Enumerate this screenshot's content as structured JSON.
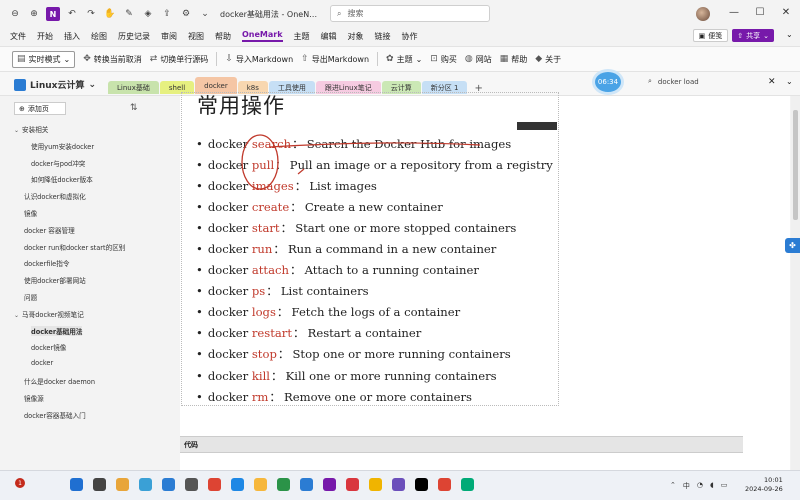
{
  "titlebar": {
    "title": "docker基础用法 - OneN…",
    "search_placeholder": "搜索"
  },
  "menu": {
    "items": [
      "文件",
      "开始",
      "插入",
      "绘图",
      "历史记录",
      "审阅",
      "视图",
      "帮助",
      "OneMark",
      "主题",
      "编辑",
      "对象",
      "链接",
      "协作"
    ],
    "active": "OneMark",
    "sticky_label": "便笺",
    "share_label": "共享"
  },
  "ribbon": {
    "live_mode": "实时模式",
    "convert_current": "转换当前取消",
    "switch_single_line": "切换单行源码",
    "import_markdown": "导入Markdown",
    "export_markdown": "导出Markdown",
    "theme": "主题",
    "buy": "购买",
    "website": "网站",
    "help": "帮助",
    "about": "关于"
  },
  "notebook": {
    "name": "Linux云计算",
    "tabs": [
      {
        "label": "Linux基础",
        "color": "#c8e3ac"
      },
      {
        "label": "shell",
        "color": "#e6f080"
      },
      {
        "label": "docker",
        "color": "#f5c6a5"
      },
      {
        "label": "k8s",
        "color": "#f8d7b0"
      },
      {
        "label": "工具使用",
        "color": "#c6dff5"
      },
      {
        "label": "跟进Linux笔记",
        "color": "#f6cbe1"
      },
      {
        "label": "云计算",
        "color": "#cbe8b5"
      },
      {
        "label": "新分区 1",
        "color": "#c6dff5"
      }
    ],
    "active_tab": "docker",
    "timer": "06:34",
    "page_search": "docker load"
  },
  "sidebar": {
    "add_page": "添加页",
    "items": [
      {
        "label": "安装相关",
        "level": 0,
        "caret": true
      },
      {
        "label": "使用yum安装docker",
        "level": 1
      },
      {
        "label": "docker与pod冲突",
        "level": 1
      },
      {
        "label": "如何降低docker版本",
        "level": 1
      },
      {
        "label": "认识docker和虚拟化",
        "level": 0
      },
      {
        "label": "镜像",
        "level": 0
      },
      {
        "label": "docker 容器管理",
        "level": 0
      },
      {
        "label": "docker run和docker start的区别",
        "level": 0
      },
      {
        "label": "dockerfile指令",
        "level": 0
      },
      {
        "label": "使用docker部署网站",
        "level": 0
      },
      {
        "label": "问题",
        "level": 0
      },
      {
        "label": "马哥docker视频笔记",
        "level": 0,
        "caret": true
      },
      {
        "label": "docker基础用法",
        "level": 1,
        "selected": true
      },
      {
        "label": "docker镜像",
        "level": 1
      },
      {
        "label": "docker",
        "level": 1
      },
      {
        "label": "什么是docker daemon",
        "level": 0
      },
      {
        "label": "镜像源",
        "level": 0
      },
      {
        "label": "docker容器基础入门",
        "level": 0
      }
    ]
  },
  "note": {
    "title": "常用操作",
    "commands": [
      {
        "cmd": "docker",
        "sub": "search",
        "desc": "Search the Docker Hub for images"
      },
      {
        "cmd": "docker",
        "sub": "pull",
        "desc": "Pull an image or a repository from a registry"
      },
      {
        "cmd": "docker",
        "sub": "images",
        "desc": "List images"
      },
      {
        "cmd": "docker",
        "sub": "create",
        "desc": "Create a new container"
      },
      {
        "cmd": "docker",
        "sub": "start",
        "desc": "Start one or more stopped containers"
      },
      {
        "cmd": "docker",
        "sub": "run",
        "desc": "Run a command in a new container"
      },
      {
        "cmd": "docker",
        "sub": "attach",
        "desc": "Attach to a running container"
      },
      {
        "cmd": "docker",
        "sub": "ps",
        "desc": "List containers"
      },
      {
        "cmd": "docker",
        "sub": "logs",
        "desc": "Fetch the logs of a container"
      },
      {
        "cmd": "docker",
        "sub": "restart",
        "desc": "Restart a container"
      },
      {
        "cmd": "docker",
        "sub": "stop",
        "desc": "Stop one or more running containers"
      },
      {
        "cmd": "docker",
        "sub": "kill",
        "desc": "Kill one or more running containers"
      },
      {
        "cmd": "docker",
        "sub": "rm",
        "desc": "Remove one or more containers"
      }
    ],
    "code_label": "代码"
  },
  "taskbar": {
    "time": "10:01",
    "date": "2024-09-26",
    "notification_count": "1",
    "lang": "中",
    "icons": [
      "#1f6fd1",
      "#444",
      "#e8a53a",
      "#3aa0d6",
      "#2b7cd3",
      "#555",
      "#d43",
      "#1e88e5",
      "#f6b73c",
      "#2b9348",
      "#2b7cd3",
      "#7719aa",
      "#d9363e",
      "#f0b400",
      "#6b4fbb",
      "#000",
      "#d43",
      "#0a7"
    ]
  }
}
